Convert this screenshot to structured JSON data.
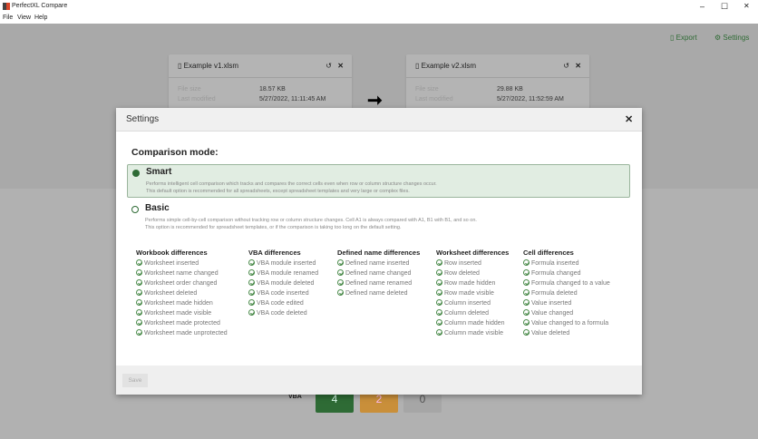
{
  "app": {
    "title": "PerfectXL Compare",
    "menu": [
      "File",
      "View",
      "Help"
    ],
    "window_controls": [
      "–",
      "☐",
      "✕"
    ]
  },
  "toolbar": {
    "export": "Export",
    "settings": "Settings"
  },
  "files": [
    {
      "name": "Example v1.xlsm",
      "size_label": "File size",
      "size": "18.57 KB",
      "modified_label": "Last modified",
      "modified": "5/27/2022, 11:11:45 AM"
    },
    {
      "name": "Example v2.xlsm",
      "size_label": "File size",
      "size": "29.88 KB",
      "modified_label": "Last modified",
      "modified": "5/27/2022, 11:52:59 AM"
    }
  ],
  "dialog": {
    "title": "Settings",
    "mode_heading": "Comparison mode:",
    "selected_mode": "Smart",
    "options": [
      {
        "label": "Smart",
        "desc1": "Performs intelligent cell comparison which tracks and compares the correct cells even when row or column structure changes occur.",
        "desc2": "This default option is recommended for all spreadsheets, except spreadsheet templates and very large or complex files."
      },
      {
        "label": "Basic",
        "desc1": "Performs simple cell-by-cell comparison without tracking row or column structure changes. Cell A1 is always compared with A1, B1 with B1, and so on.",
        "desc2": "This option is recommended for spreadsheet templates, or if the comparison is taking too long on the default setting."
      }
    ],
    "groups": [
      {
        "title": "Workbook differences",
        "items": [
          "Worksheet inserted",
          "Worksheet name changed",
          "Worksheet order changed",
          "Worksheet deleted",
          "Worksheet made hidden",
          "Worksheet made visible",
          "Worksheet made protected",
          "Worksheet made unprotected"
        ]
      },
      {
        "title": "VBA differences",
        "items": [
          "VBA module inserted",
          "VBA module renamed",
          "VBA module deleted",
          "VBA code inserted",
          "VBA code edited",
          "VBA code deleted"
        ]
      },
      {
        "title": "Defined name differences",
        "items": [
          "Defined name inserted",
          "Defined name changed",
          "Defined name renamed",
          "Defined name deleted"
        ]
      },
      {
        "title": "Worksheet differences",
        "items": [
          "Row inserted",
          "Row deleted",
          "Row made hidden",
          "Row made visible",
          "Column inserted",
          "Column deleted",
          "Column made hidden",
          "Column made visible"
        ]
      },
      {
        "title": "Cell differences",
        "items": [
          "Formula inserted",
          "Formula changed",
          "Formula changed to a value",
          "Formula deleted",
          "Value inserted",
          "Value changed",
          "Value changed to a formula",
          "Value deleted"
        ]
      }
    ],
    "save": "Save"
  },
  "summary": {
    "label": "VBA",
    "counts": [
      "4",
      "2",
      "0"
    ],
    "colors": [
      "#2e6b35",
      "#c98f3a",
      "#a6a6a6"
    ]
  }
}
